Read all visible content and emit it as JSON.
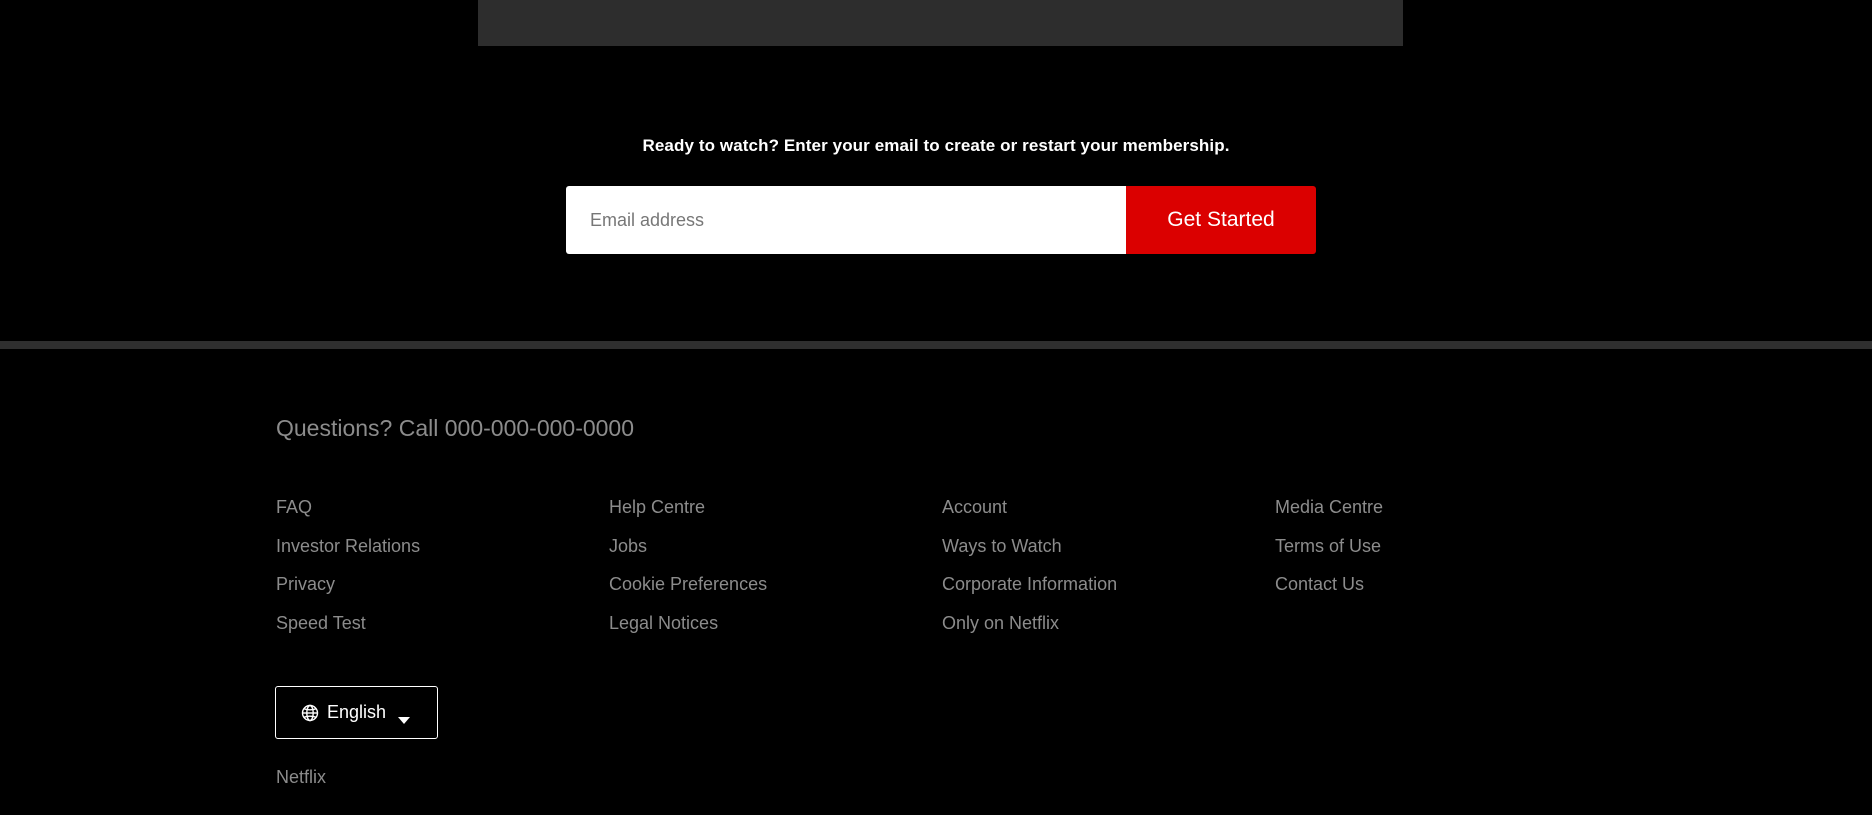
{
  "cta": {
    "text": "Ready to watch? Enter your email to create or restart your membership.",
    "email_placeholder": "Email address",
    "email_value": "",
    "button_label": "Get Started"
  },
  "footer": {
    "questions": "Questions? Call 000-000-000-0000",
    "columns": [
      [
        "FAQ",
        "Investor Relations",
        "Privacy",
        "Speed Test"
      ],
      [
        "Help Centre",
        "Jobs",
        "Cookie Preferences",
        "Legal Notices"
      ],
      [
        "Account",
        "Ways to Watch",
        "Corporate Information",
        "Only on Netflix"
      ],
      [
        "Media Centre",
        "Terms of Use",
        "Contact Us"
      ]
    ],
    "language": {
      "selected": "English",
      "globe_icon": "globe-icon",
      "caret_icon": "caret-down-icon"
    },
    "brand": "Netflix"
  },
  "colors": {
    "background": "#000000",
    "accent_red": "#db0000",
    "muted_text": "#8c8c8c",
    "divider": "#2f2f2f"
  }
}
